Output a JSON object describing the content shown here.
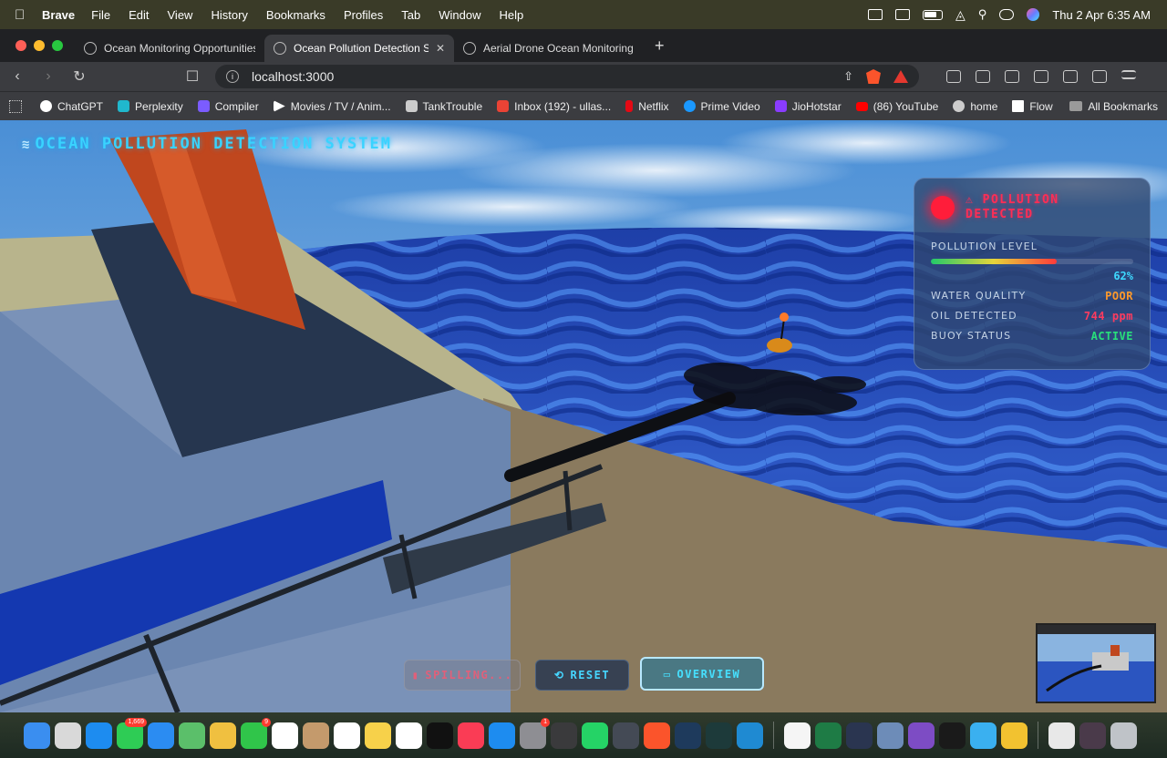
{
  "menubar": {
    "app": "Brave",
    "items": [
      "File",
      "Edit",
      "View",
      "History",
      "Bookmarks",
      "Profiles",
      "Tab",
      "Window",
      "Help"
    ],
    "datetime": "Thu 2 Apr  6:35 AM"
  },
  "tabs": [
    {
      "title": "Ocean Monitoring Opportunities",
      "icon": "chatgpt-icon",
      "active": false
    },
    {
      "title": "Ocean Pollution Detection Simulator",
      "icon": "globe-icon",
      "active": true
    },
    {
      "title": "Aerial Drone Ocean Monitoring | UAV",
      "icon": "globe-icon",
      "active": false
    }
  ],
  "address_bar": {
    "url": "localhost:3000"
  },
  "bookmarks": [
    {
      "label": "ChatGPT",
      "icon": "chatgpt-icon",
      "color": "#ffffff"
    },
    {
      "label": "Perplexity",
      "icon": "perplexity-icon",
      "color": "#20b8cd"
    },
    {
      "label": "Compiler",
      "icon": "compiler-icon",
      "color": "#7b5cff"
    },
    {
      "label": "Movies / TV / Anim...",
      "icon": "play-icon",
      "color": "#ffffff"
    },
    {
      "label": "TankTrouble",
      "icon": "tank-icon",
      "color": "#cccccc"
    },
    {
      "label": "Inbox (192) - ullas...",
      "icon": "gmail-icon",
      "color": "#ea4335"
    },
    {
      "label": "Netflix",
      "icon": "netflix-icon",
      "color": "#e50914"
    },
    {
      "label": "Prime Video",
      "icon": "prime-icon",
      "color": "#1a98ff"
    },
    {
      "label": "JioHotstar",
      "icon": "hotstar-icon",
      "color": "#8a3cff"
    },
    {
      "label": "(86) YouTube",
      "icon": "youtube-icon",
      "color": "#ff0000"
    },
    {
      "label": "home",
      "icon": "globe-icon",
      "color": "#cccccc"
    },
    {
      "label": "Flow",
      "icon": "page-icon",
      "color": "#ffffff"
    }
  ],
  "all_bookmarks_label": "All Bookmarks",
  "app": {
    "title": "OCEAN POLLUTION DETECTION SYSTEM",
    "title_icon": "wave-icon"
  },
  "status_panel": {
    "alert": "⚠ POLLUTION DETECTED",
    "alert_color": "#ff2d55",
    "pollution_label": "POLLUTION LEVEL",
    "pollution_value": "62%",
    "pollution_fraction": 0.62,
    "rows": [
      {
        "label": "WATER QUALITY",
        "value": "POOR",
        "color": "#ff9a2a"
      },
      {
        "label": "OIL DETECTED",
        "value": "744 ppm",
        "color": "#ff3b5f"
      },
      {
        "label": "BUOY STATUS",
        "value": "ACTIVE",
        "color": "#28e07a"
      }
    ]
  },
  "controls": {
    "spill": {
      "icon": "spill-icon",
      "label": "SPILLING..."
    },
    "reset": {
      "icon": "reset-icon",
      "label": "RESET"
    },
    "overview": {
      "icon": "camera-icon",
      "label": "OVERVIEW"
    }
  },
  "dock": {
    "apps": [
      {
        "name": "finder",
        "color": "#3a8ef0"
      },
      {
        "name": "launchpad",
        "color": "#d9d9d9"
      },
      {
        "name": "safari",
        "color": "#1d8cf0"
      },
      {
        "name": "messages",
        "color": "#2ecc55",
        "badge": "1,669"
      },
      {
        "name": "mail",
        "color": "#2b8cf2"
      },
      {
        "name": "maps",
        "color": "#5bbf6a"
      },
      {
        "name": "photos",
        "color": "#f0c040"
      },
      {
        "name": "facetime",
        "color": "#30c54a",
        "badge": "9"
      },
      {
        "name": "calendar",
        "color": "#ffffff"
      },
      {
        "name": "contacts",
        "color": "#c49a6c"
      },
      {
        "name": "reminders",
        "color": "#ffffff"
      },
      {
        "name": "notes",
        "color": "#f7d14a"
      },
      {
        "name": "freeform",
        "color": "#ffffff"
      },
      {
        "name": "tv",
        "color": "#111111"
      },
      {
        "name": "music",
        "color": "#fa3c55"
      },
      {
        "name": "app-store",
        "color": "#1d8cf0"
      },
      {
        "name": "system-settings",
        "color": "#8e8e93",
        "badge": "1"
      },
      {
        "name": "iphone-mirroring",
        "color": "#3a3a3c"
      },
      {
        "name": "whatsapp",
        "color": "#25d366"
      },
      {
        "name": "quicktime",
        "color": "#444a55"
      },
      {
        "name": "brave",
        "color": "#fb542b"
      },
      {
        "name": "copilot",
        "color": "#1e3a5c"
      },
      {
        "name": "perplexity",
        "color": "#1d3a3a"
      },
      {
        "name": "vscode",
        "color": "#1f8ad2"
      },
      {
        "name": "textedit",
        "color": "#f5f5f5"
      },
      {
        "name": "excel",
        "color": "#1e7b45"
      },
      {
        "name": "altair",
        "color": "#2a3550"
      },
      {
        "name": "preview",
        "color": "#6d8cb8"
      },
      {
        "name": "tor",
        "color": "#7d4cc4"
      },
      {
        "name": "terminal",
        "color": "#1a1a1a"
      },
      {
        "name": "keychain",
        "color": "#3ab0f0"
      },
      {
        "name": "chrome",
        "color": "#f2c230"
      },
      {
        "name": "document",
        "color": "#e8e8e8"
      },
      {
        "name": "screenshot",
        "color": "#4a3a4a"
      },
      {
        "name": "trash",
        "color": "#bfc3c8"
      }
    ]
  }
}
